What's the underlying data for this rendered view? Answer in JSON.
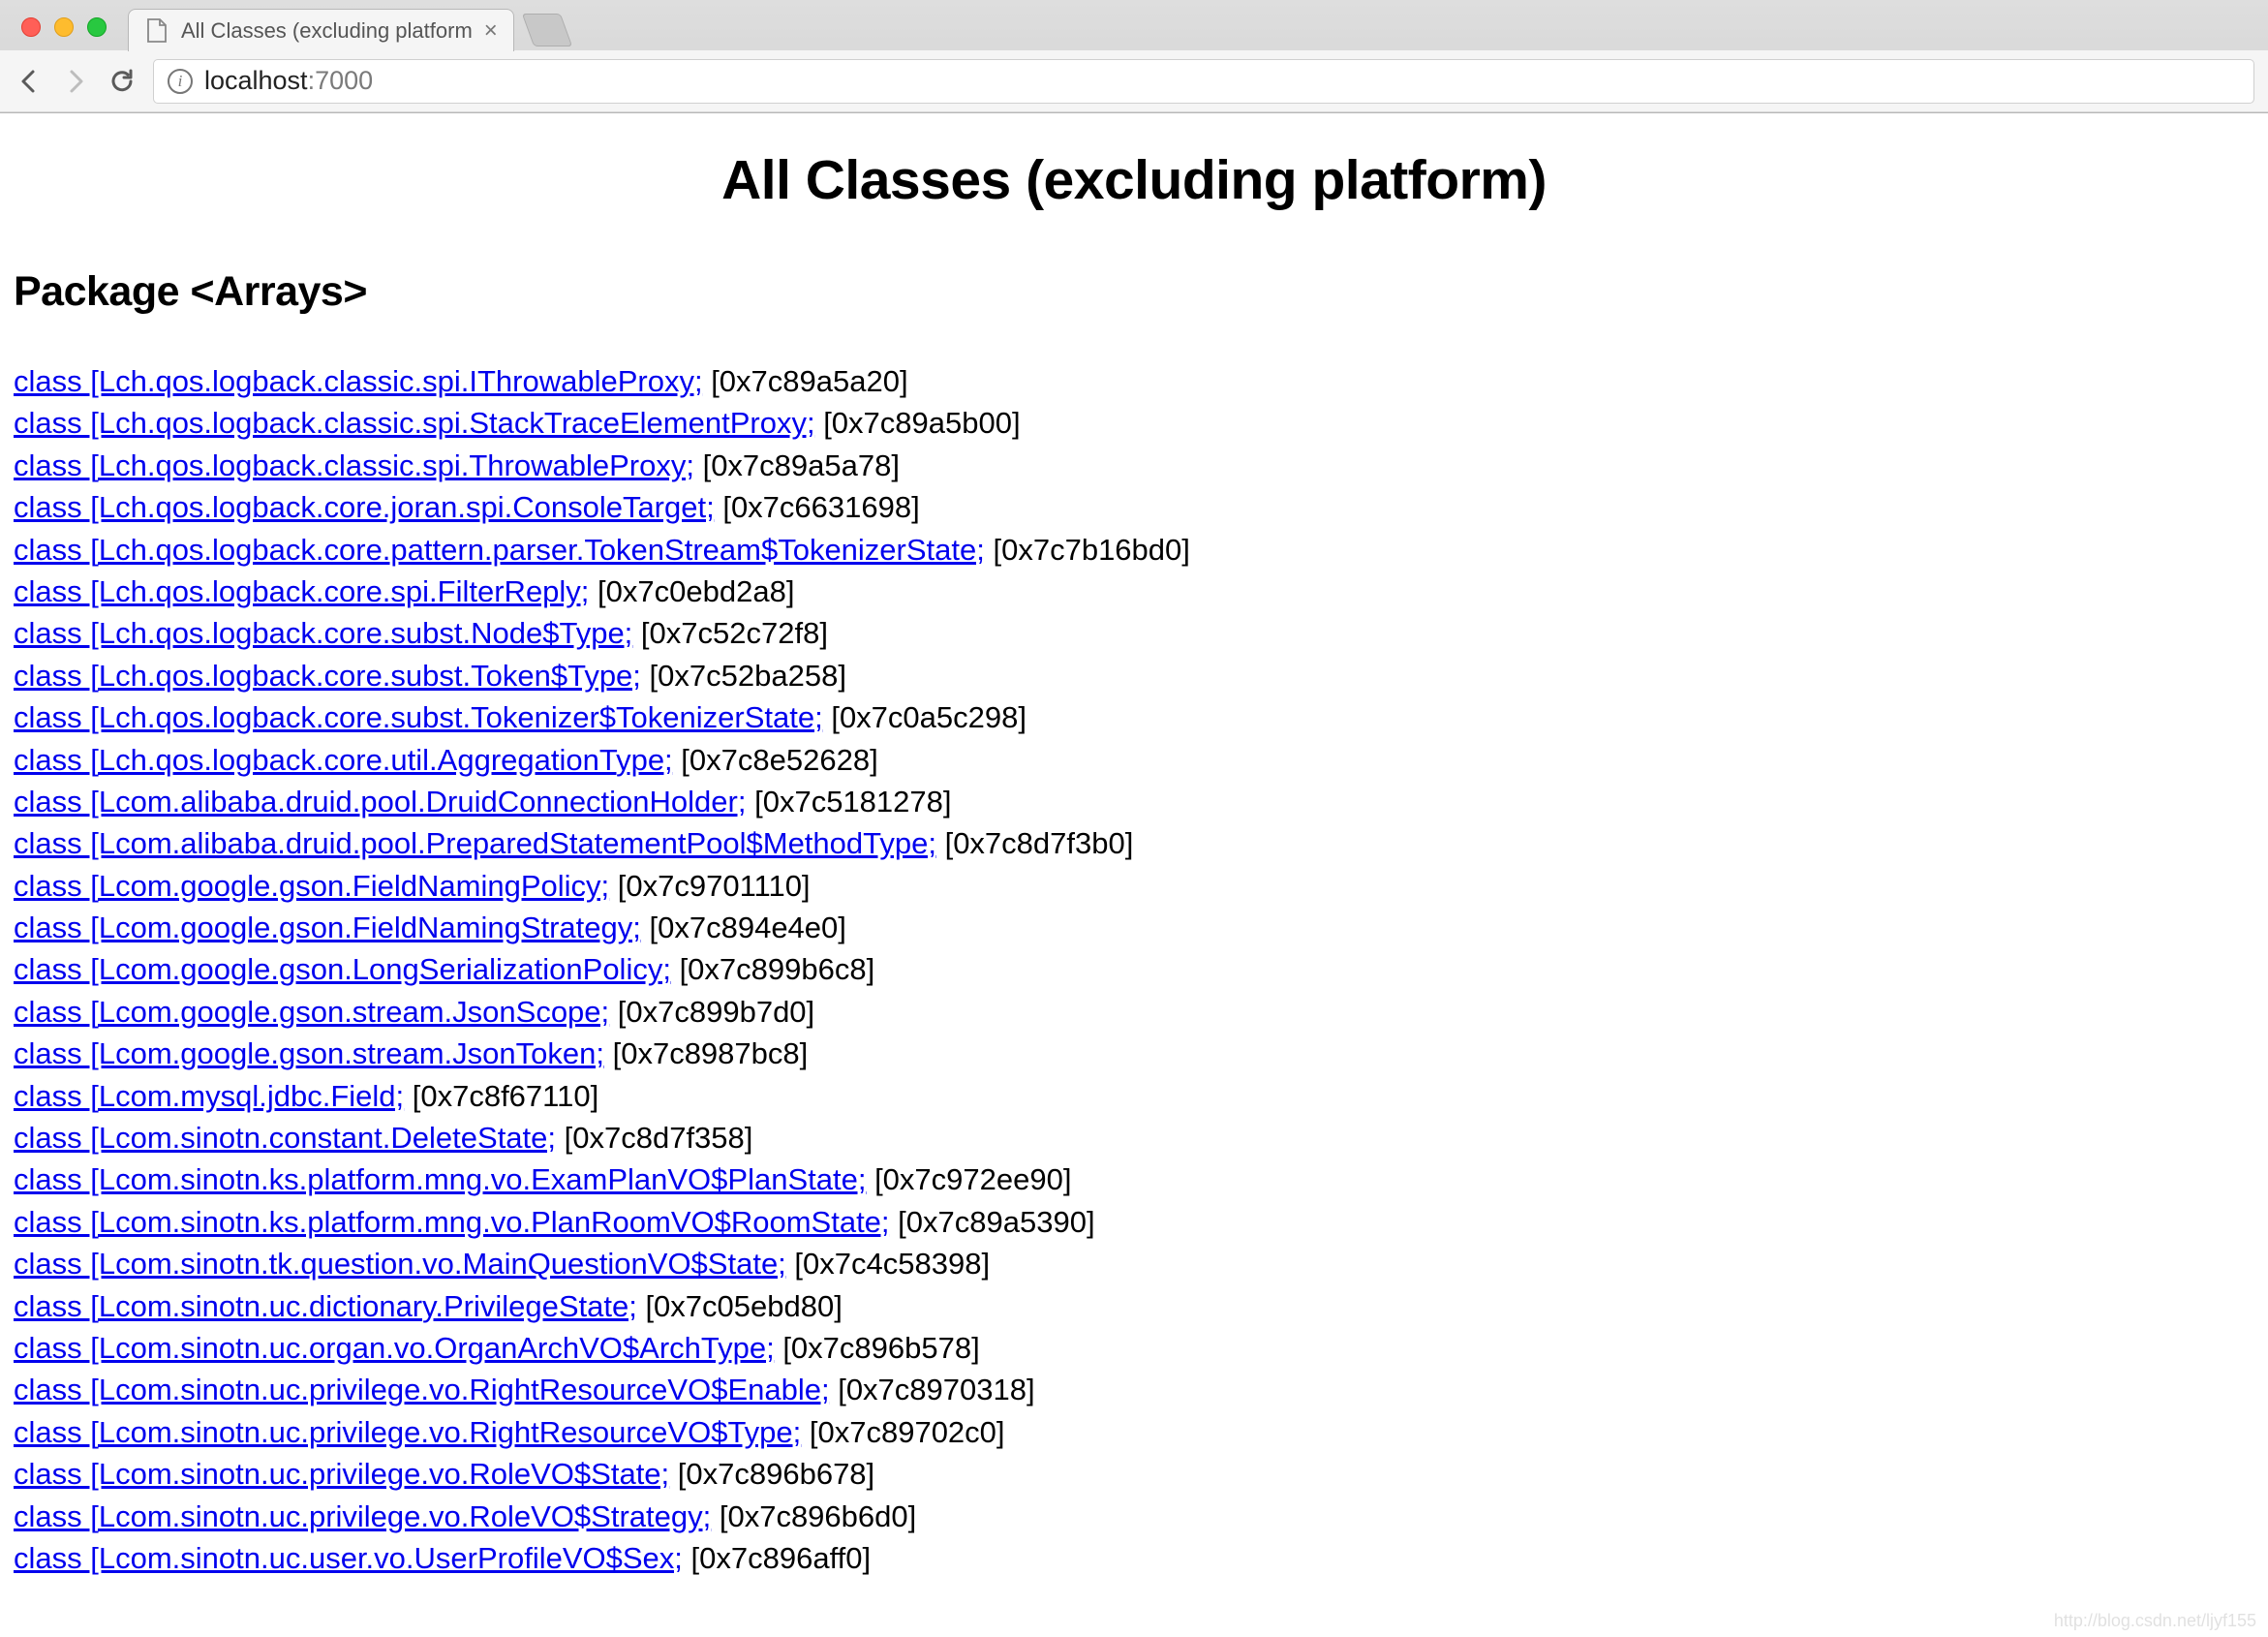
{
  "browser": {
    "tab_title": "All Classes (excluding platform",
    "url_host": "localhost",
    "url_port": ":7000"
  },
  "page": {
    "title": "All Classes (excluding platform)",
    "package_heading": "Package <Arrays>"
  },
  "entries": [
    {
      "link": "class [Lch.qos.logback.classic.spi.IThrowableProxy;",
      "addr": "[0x7c89a5a20]"
    },
    {
      "link": "class [Lch.qos.logback.classic.spi.StackTraceElementProxy;",
      "addr": "[0x7c89a5b00]"
    },
    {
      "link": "class [Lch.qos.logback.classic.spi.ThrowableProxy;",
      "addr": "[0x7c89a5a78]"
    },
    {
      "link": "class [Lch.qos.logback.core.joran.spi.ConsoleTarget;",
      "addr": "[0x7c6631698]"
    },
    {
      "link": "class [Lch.qos.logback.core.pattern.parser.TokenStream$TokenizerState;",
      "addr": "[0x7c7b16bd0]"
    },
    {
      "link": "class [Lch.qos.logback.core.spi.FilterReply;",
      "addr": "[0x7c0ebd2a8]"
    },
    {
      "link": "class [Lch.qos.logback.core.subst.Node$Type;",
      "addr": "[0x7c52c72f8]"
    },
    {
      "link": "class [Lch.qos.logback.core.subst.Token$Type;",
      "addr": "[0x7c52ba258]"
    },
    {
      "link": "class [Lch.qos.logback.core.subst.Tokenizer$TokenizerState;",
      "addr": "[0x7c0a5c298]"
    },
    {
      "link": "class [Lch.qos.logback.core.util.AggregationType;",
      "addr": "[0x7c8e52628]"
    },
    {
      "link": "class [Lcom.alibaba.druid.pool.DruidConnectionHolder;",
      "addr": "[0x7c5181278]"
    },
    {
      "link": "class [Lcom.alibaba.druid.pool.PreparedStatementPool$MethodType;",
      "addr": "[0x7c8d7f3b0]"
    },
    {
      "link": "class [Lcom.google.gson.FieldNamingPolicy;",
      "addr": "[0x7c9701110]"
    },
    {
      "link": "class [Lcom.google.gson.FieldNamingStrategy;",
      "addr": "[0x7c894e4e0]"
    },
    {
      "link": "class [Lcom.google.gson.LongSerializationPolicy;",
      "addr": "[0x7c899b6c8]"
    },
    {
      "link": "class [Lcom.google.gson.stream.JsonScope;",
      "addr": "[0x7c899b7d0]"
    },
    {
      "link": "class [Lcom.google.gson.stream.JsonToken;",
      "addr": "[0x7c8987bc8]"
    },
    {
      "link": "class [Lcom.mysql.jdbc.Field;",
      "addr": "[0x7c8f67110]"
    },
    {
      "link": "class [Lcom.sinotn.constant.DeleteState;",
      "addr": "[0x7c8d7f358]"
    },
    {
      "link": "class [Lcom.sinotn.ks.platform.mng.vo.ExamPlanVO$PlanState;",
      "addr": "[0x7c972ee90]"
    },
    {
      "link": "class [Lcom.sinotn.ks.platform.mng.vo.PlanRoomVO$RoomState;",
      "addr": "[0x7c89a5390]"
    },
    {
      "link": "class [Lcom.sinotn.tk.question.vo.MainQuestionVO$State;",
      "addr": "[0x7c4c58398]"
    },
    {
      "link": "class [Lcom.sinotn.uc.dictionary.PrivilegeState;",
      "addr": "[0x7c05ebd80]"
    },
    {
      "link": "class [Lcom.sinotn.uc.organ.vo.OrganArchVO$ArchType;",
      "addr": "[0x7c896b578]"
    },
    {
      "link": "class [Lcom.sinotn.uc.privilege.vo.RightResourceVO$Enable;",
      "addr": "[0x7c8970318]"
    },
    {
      "link": "class [Lcom.sinotn.uc.privilege.vo.RightResourceVO$Type;",
      "addr": "[0x7c89702c0]"
    },
    {
      "link": "class [Lcom.sinotn.uc.privilege.vo.RoleVO$State;",
      "addr": "[0x7c896b678]"
    },
    {
      "link": "class [Lcom.sinotn.uc.privilege.vo.RoleVO$Strategy;",
      "addr": "[0x7c896b6d0]"
    },
    {
      "link": "class [Lcom.sinotn.uc.user.vo.UserProfileVO$Sex;",
      "addr": "[0x7c896aff0]"
    }
  ],
  "watermark": "http://blog.csdn.net/ljyf155"
}
